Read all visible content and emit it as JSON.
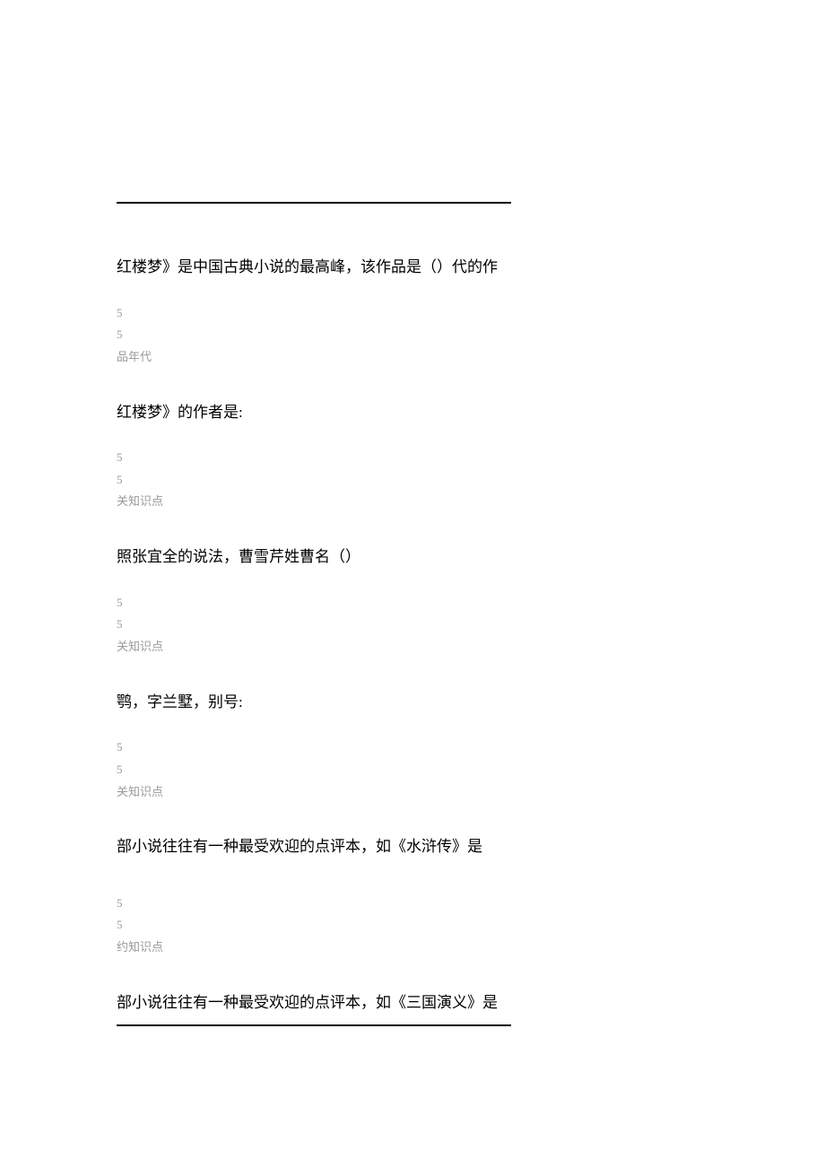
{
  "questions": [
    {
      "title": "红楼梦》是中国古典小说的最高峰，该作品是（）代的作",
      "meta1": "5",
      "meta2": "5",
      "meta3": "品年代"
    },
    {
      "title": "红楼梦》的作者是:",
      "meta1": "5",
      "meta2": "5",
      "meta3": "关知识点"
    },
    {
      "title": "照张宜全的说法，曹雪芹姓曹名（）",
      "meta1": "5",
      "meta2": "5",
      "meta3": "关知识点"
    },
    {
      "title": "鹗，字兰墅，别号:",
      "meta1": "5",
      "meta2": "5",
      "meta3": "关知识点"
    },
    {
      "title": "部小说往往有一种最受欢迎的点评本，如《水浒传》是",
      "meta1": "5",
      "meta2": "5",
      "meta3": "约知识点"
    }
  ],
  "bottomQuestion": "部小说往往有一种最受欢迎的点评本，如《三国演义》是"
}
